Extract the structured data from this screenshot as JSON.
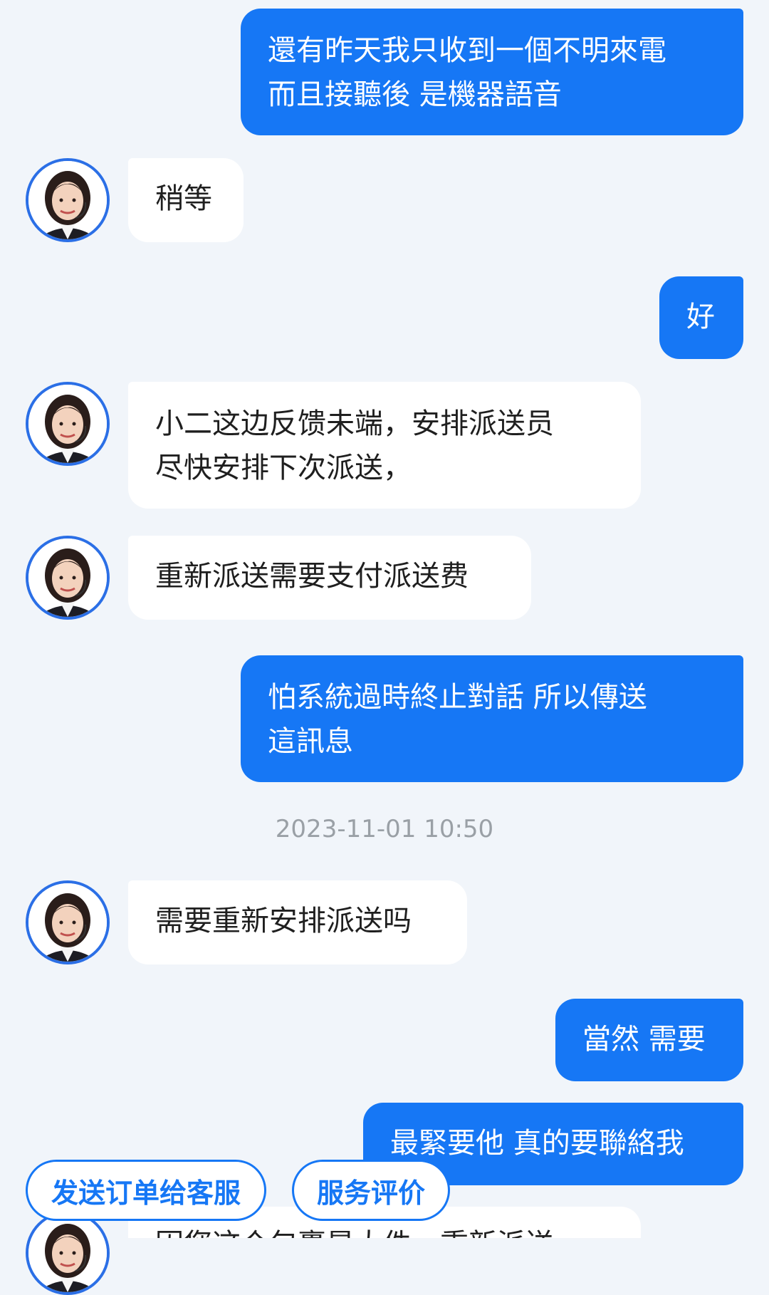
{
  "messages": [
    {
      "side": "out",
      "text": "還有昨天我只收到一個不明來電\n而且接聽後 是機器語音"
    },
    {
      "side": "in",
      "text": "稍等"
    },
    {
      "side": "out",
      "text": "好"
    },
    {
      "side": "in",
      "text": "小二这边反馈未端，安排派送员\n尽快安排下次派送，"
    },
    {
      "side": "in",
      "text": "重新派送需要支付派送费"
    },
    {
      "side": "out",
      "text": "怕系統過時終止對話 所以傳送\n這訊息"
    },
    {
      "side": "in",
      "text": "需要重新安排派送吗"
    },
    {
      "side": "out",
      "text": "當然 需要"
    },
    {
      "side": "out",
      "text": "最緊要他 真的要聯絡我"
    },
    {
      "side": "in",
      "text": "因您这个包裹是大件，重新派送"
    }
  ],
  "timestamp": "2023-11-01 10:50",
  "quick_actions": {
    "send_order": "发送订单给客服",
    "rate_service": "服务评价"
  },
  "colors": {
    "accent": "#1677f5",
    "background": "#f1f5fa",
    "incoming_bubble": "#ffffff"
  }
}
